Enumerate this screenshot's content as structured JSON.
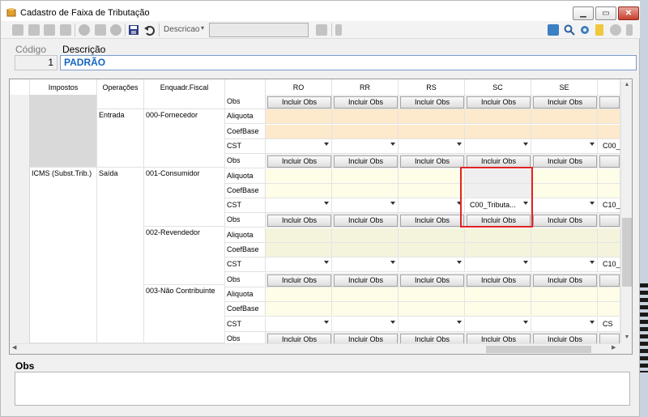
{
  "window": {
    "title": "Cadastro de Faixa de Tributação"
  },
  "toolbar": {
    "search_label": "Descricao",
    "search_value": ""
  },
  "form": {
    "codigo_label": "Código",
    "descricao_label": "Descrição",
    "codigo_value": "1",
    "descricao_value": "PADRÃO"
  },
  "grid": {
    "headers": {
      "impostos": "Impostos",
      "operacoes": "Operações",
      "enquadr": "Enquadr.Fiscal"
    },
    "states": [
      "RO",
      "RR",
      "RS",
      "SC",
      "SE"
    ],
    "tax_label": "ICMS (Subst.Trib.)",
    "operations": [
      "Entrada",
      "Saída"
    ],
    "enquadramentos": [
      "000-Fornecedor",
      "001-Consumidor",
      "002-Revendedor",
      "003-Não Contribuinte"
    ],
    "fields": {
      "aliquota": "Aliquota",
      "coefbase": "CoefBase",
      "cst": "CST",
      "obs": "Obs"
    },
    "button_label": "Incluir Obs",
    "cst_highlight_value": "C00_Tributa...",
    "partial_values": {
      "fornecedor_cst": "C00_",
      "consumidor_cst": "C10_",
      "revendedor_cst": "C10_",
      "nao_contrib_cst": "CS"
    }
  },
  "obs": {
    "label": "Obs"
  },
  "colors": {
    "highlight": "#e32323",
    "descricao_text": "#1565c0"
  }
}
